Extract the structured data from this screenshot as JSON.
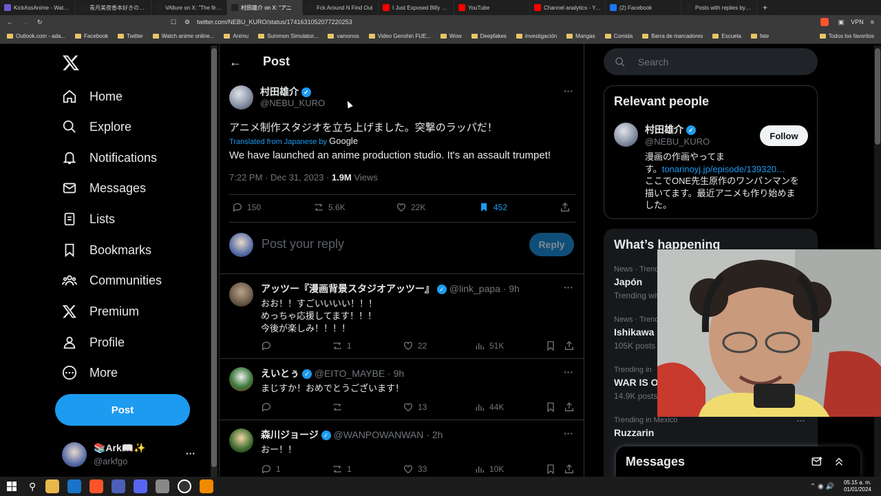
{
  "browser": {
    "tabs": [
      {
        "title": "KickAssAnime - Watch A",
        "color": "#6a5acd"
      },
      {
        "title": "青月美夜香本好きの下剋",
        "color": "#222"
      },
      {
        "title": "VAllure on X: \"The first I",
        "color": "#222"
      },
      {
        "title": "村田雄介 on X: \"アニ",
        "color": "#222"
      },
      {
        "title": "Fck Around N Find Out",
        "color": "#222"
      },
      {
        "title": "I Just Exposed Billy Mitc",
        "color": "#ff0000"
      },
      {
        "title": "YouTube",
        "color": "#ff0000"
      },
      {
        "title": "Channel analytics - YouT",
        "color": "#ff0000"
      },
      {
        "title": "(2) Facebook",
        "color": "#1877f2"
      },
      {
        "title": "Posts with replies by 村田",
        "color": "#222"
      }
    ],
    "url": "twitter.com/NEBU_KURO/status/1741631052077220253",
    "vpn_label": "VPN",
    "bookmarks": [
      "Outlook.com - ada...",
      "Facebook",
      "Twitter",
      "Watch anime online...",
      "Animu",
      "Summon Simulator...",
      "vamonos",
      "Video Genshin FUE...",
      "Wow",
      "Deepfakes",
      "investigación",
      "Mangas",
      "Comida",
      "Barra de marcadores",
      "Escuela",
      "fate"
    ],
    "all_bookmarks": "Todos los favoritos"
  },
  "nav": {
    "items": [
      "Home",
      "Explore",
      "Notifications",
      "Messages",
      "Lists",
      "Bookmarks",
      "Communities",
      "Premium",
      "Profile",
      "More"
    ],
    "post_label": "Post",
    "account_name": "📚Ark📖✨",
    "account_handle": "@arkfgo",
    "more_label": "···"
  },
  "header": {
    "title": "Post"
  },
  "post": {
    "author": "村田雄介",
    "handle": "@NEBU_KURO",
    "text": "アニメ制作スタジオを立ち上げました。突撃のラッパだ！",
    "translated_from": "Translated from Japanese by",
    "translator": "Google",
    "translation": "We have launched an anime production studio. It's an assault trumpet!",
    "time": "7:22 PM · Dec 31, 2023 · ",
    "views": "1.9M",
    "views_label": " Views",
    "replies": "150",
    "reposts": "5.6K",
    "likes": "22K",
    "bookmarks": "452"
  },
  "composer": {
    "placeholder": "Post your reply",
    "button": "Reply"
  },
  "replies": [
    {
      "name": "アッツー『漫画背景スタジオアッツー』",
      "handle": "@link_papa · 9h",
      "lines": [
        "おお！！すごいいいい！！！",
        "めっちゃ応援してます！！！",
        "今後が楽しみ！！！！"
      ],
      "replies": "",
      "reposts": "1",
      "likes": "22",
      "views": "51K"
    },
    {
      "name": "えいとぅ",
      "handle": "@EITO_MAYBE · 9h",
      "lines": [
        "まじすか！おめでとうございます！"
      ],
      "replies": "",
      "reposts": "",
      "likes": "13",
      "views": "44K"
    },
    {
      "name": "森川ジョージ",
      "handle": "@WANPOWANWAN · 2h",
      "lines": [
        "おー！！"
      ],
      "replies": "1",
      "reposts": "1",
      "likes": "33",
      "views": "10K"
    }
  ],
  "search": {
    "placeholder": "Search"
  },
  "relevant": {
    "title": "Relevant people",
    "name": "村田雄介",
    "handle": "@NEBU_KURO",
    "follow": "Follow",
    "bio_1": "漫画の作画やってま",
    "bio_2": "す。",
    "bio_link": "tonarinoyj.jp/episode/139320…",
    "bio_3": "ここでONE先生原作のワンパンマンを",
    "bio_4": "描いてます。最近アニメも作り始めま",
    "bio_5": "した。"
  },
  "trends": {
    "title": "What’s happening",
    "items": [
      {
        "context": "News · Trend",
        "name": "Japón",
        "meta": "Trending wit"
      },
      {
        "context": "News · Trend",
        "name": "Ishikawa",
        "meta": "105K posts"
      },
      {
        "context": "Trending in",
        "name": "WAR IS OV",
        "meta": "14.9K posts"
      },
      {
        "context": "Trending in Mexico",
        "name": "Ruzzarin",
        "meta": ""
      }
    ]
  },
  "messages_drawer": {
    "title": "Messages"
  },
  "taskbar": {
    "time": "05:15 a. m.",
    "date": "01/01/2024"
  }
}
